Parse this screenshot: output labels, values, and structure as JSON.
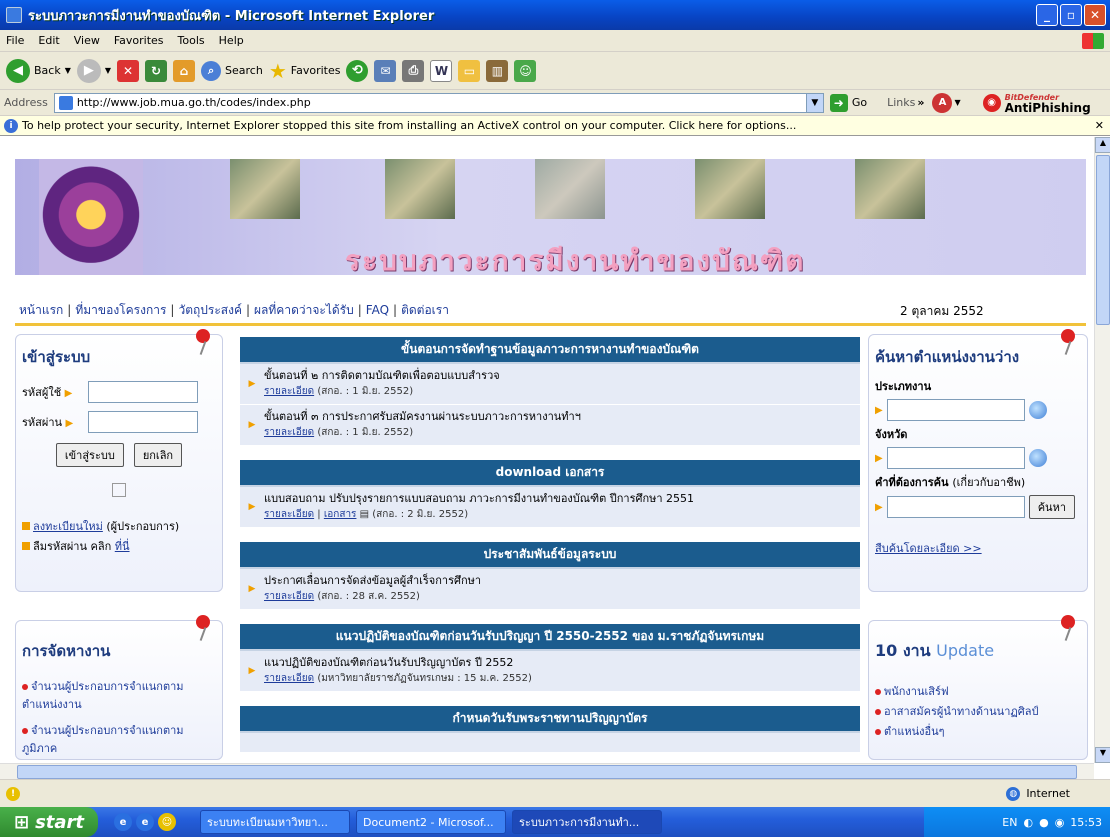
{
  "window": {
    "title": "ระบบภาวะการมีงานทำของบัณฑิต - Microsoft Internet Explorer"
  },
  "menu": [
    "File",
    "Edit",
    "View",
    "Favorites",
    "Tools",
    "Help"
  ],
  "toolbar": {
    "back": "Back",
    "search": "Search",
    "favorites": "Favorites"
  },
  "address": {
    "label": "Address",
    "url": "http://www.job.mua.go.th/codes/index.php",
    "go": "Go",
    "links": "Links",
    "antiphishing": "AntiPhishing",
    "bitdefender": "BitDefender"
  },
  "infobar": {
    "text": "To help protect your security, Internet Explorer stopped this site from installing an ActiveX control on your computer. Click here for options..."
  },
  "banner": {
    "title": "ระบบภาวะการมีงานทำของบัณฑิต"
  },
  "nav": {
    "items": [
      "หน้าแรก",
      "ที่มาของโครงการ",
      "วัตถุประสงค์",
      "ผลที่คาดว่าจะได้รับ",
      "FAQ",
      "ติดต่อเรา"
    ],
    "date": "2 ตุลาคม 2552"
  },
  "login": {
    "title": "เข้าสู่ระบบ",
    "user_label": "รหัสผู้ใช้",
    "pass_label": "รหัสผ่าน",
    "login_btn": "เข้าสู่ระบบ",
    "cancel_btn": "ยกเลิก",
    "register_link": "ลงทะเบียนใหม่",
    "register_suffix": "(ผู้ประกอบการ)",
    "forgot_text": "ลืมรหัสผ่าน คลิก",
    "forgot_link": "ที่นี่"
  },
  "jobs_box": {
    "title": "การจัดหางาน",
    "items": [
      "จำนวนผู้ประกอบการจำแนกตามตำแหน่งงาน",
      "จำนวนผู้ประกอบการจำแนกตามภูมิภาค"
    ]
  },
  "sections": [
    {
      "header": "ขั้นตอนการจัดทำฐานข้อมูลภาวะการหางานทำของบัณฑิต",
      "items": [
        {
          "text": "ขั้นตอนที่ ๒ การติดตามบัณฑิตเพื่อตอบแบบสำรวจ",
          "link": "รายละเอียด",
          "meta": "(สกอ. : 1 มิ.ย. 2552)"
        },
        {
          "text": "ขั้นตอนที่ ๓ การประกาศรับสมัครงานผ่านระบบภาวะการหางานทำฯ",
          "link": "รายละเอียด",
          "meta": "(สกอ. : 1 มิ.ย. 2552)"
        }
      ]
    },
    {
      "header": "download เอกสาร",
      "items": [
        {
          "text": "แบบสอบถาม ปรับปรุงรายการแบบสอบถาม ภาวะการมีงานทำของบัณฑิต ปีการศึกษา 2551",
          "link": "รายละเอียด",
          "link2": "เอกสาร",
          "meta": "(สกอ. : 2 มิ.ย. 2552)"
        }
      ]
    },
    {
      "header": "ประชาสัมพันธ์ข้อมูลระบบ",
      "items": [
        {
          "text": "ประกาศเลื่อนการจัดส่งข้อมูลผู้สำเร็จการศึกษา",
          "link": "รายละเอียด",
          "meta": "(สกอ. : 28 ส.ค. 2552)"
        }
      ]
    },
    {
      "header": "แนวปฏิบัติของบัณฑิตก่อนวันรับปริญญา ปี 2550-2552 ของ ม.ราชภัฏจันทรเกษม",
      "items": [
        {
          "text": "แนวปฏิบัติของบัณฑิตก่อนวันรับปริญญาบัตร ปี 2552",
          "link": "รายละเอียด",
          "meta": "(มหาวิทยาลัยราชภัฏจันทรเกษม : 15 ม.ค. 2552)"
        }
      ]
    },
    {
      "header": "กำหนดวันรับพระราชทานปริญญาบัตร",
      "items": []
    }
  ],
  "search_box": {
    "title": "ค้นหาตำแหน่งงานว่าง",
    "type_label": "ประเภทงาน",
    "province_label": "จังหวัด",
    "keyword_label": "คำที่ต้องการค้น",
    "keyword_hint": "(เกี่ยวกับอาชีพ)",
    "search_btn": "ค้นหา",
    "advanced_link": "สืบค้นโดยละเอียด >>"
  },
  "update_box": {
    "title_num": "10 งาน",
    "title_word": "Update",
    "items": [
      "พนักงานเสิร์ฟ",
      "อาสาสมัครผู้นำทางด้านนาฏศิลป์",
      "ตำแหน่งอื่นๆ"
    ]
  },
  "status": {
    "zone": "Internet"
  },
  "taskbar": {
    "start": "start",
    "tasks": [
      "ระบบทะเบียนมหาวิทยา...",
      "Document2 - Microsof...",
      "ระบบภาวะการมีงานทำ..."
    ],
    "lang": "EN",
    "clock": "15:53"
  }
}
